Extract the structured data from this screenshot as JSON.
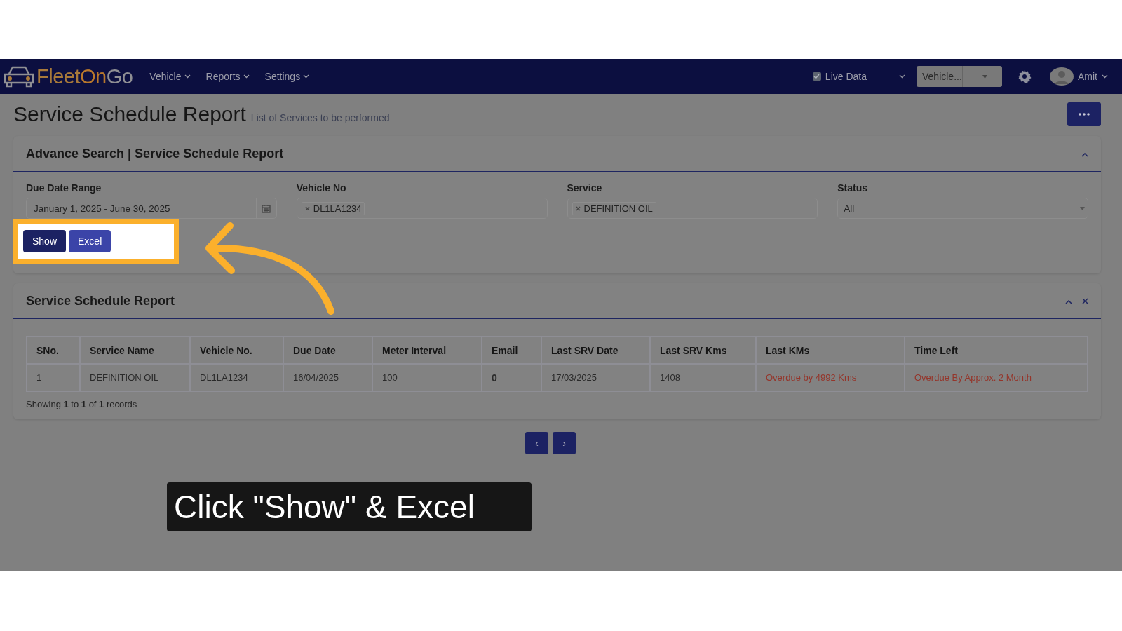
{
  "navbar": {
    "logo": [
      "Fleet",
      "On",
      "Go"
    ],
    "menus": [
      "Vehicle",
      "Reports",
      "Settings"
    ],
    "live_data": {
      "label": "Live Data",
      "checked": true
    },
    "vehicle_select": {
      "value": "Vehicle..."
    },
    "user": "Amit"
  },
  "page": {
    "title": "Service Schedule Report",
    "subtitle": "List of Services to be performed"
  },
  "search_card": {
    "title": "Advance Search | Service Schedule Report",
    "fields": [
      {
        "label": "Due Date Range",
        "kind": "date",
        "value": "January 1, 2025 - June 30, 2025"
      },
      {
        "label": "Vehicle No",
        "kind": "tags",
        "value": "DL1LA1234"
      },
      {
        "label": "Service",
        "kind": "tags",
        "value": "DEFINITION OIL"
      },
      {
        "label": "Status",
        "kind": "select",
        "value": "All"
      }
    ],
    "buttons": [
      "Show",
      "Excel"
    ]
  },
  "report_card": {
    "title": "Service Schedule Report",
    "table": {
      "columns": [
        "SNo.",
        "Service Name",
        "Vehicle No.",
        "Due Date",
        "Meter Interval",
        "Email",
        "Last SRV Date",
        "Last SRV Kms",
        "Last KMs",
        "Time Left"
      ],
      "rows": [
        [
          {
            "text": "1",
            "kind": "plain"
          },
          {
            "text": "DEFINITION OIL",
            "kind": "plain"
          },
          {
            "text": "DL1LA1234",
            "kind": "plain"
          },
          {
            "text": "16/04/2025",
            "kind": "plain"
          },
          {
            "text": "100",
            "kind": "plain"
          },
          {
            "text": "0",
            "kind": "bold"
          },
          {
            "text": "17/03/2025",
            "kind": "plain"
          },
          {
            "text": "1408",
            "kind": "plain"
          },
          {
            "text": "Overdue by 4992 Kms",
            "kind": "overdue"
          },
          {
            "text": "Overdue By Approx. 2 Month",
            "kind": "overdue"
          }
        ]
      ]
    },
    "footer": "Showing **1** to **1** of **1** records"
  },
  "pagination": [
    "‹",
    "›"
  ],
  "caption": "Click \"Show\" & Excel"
}
